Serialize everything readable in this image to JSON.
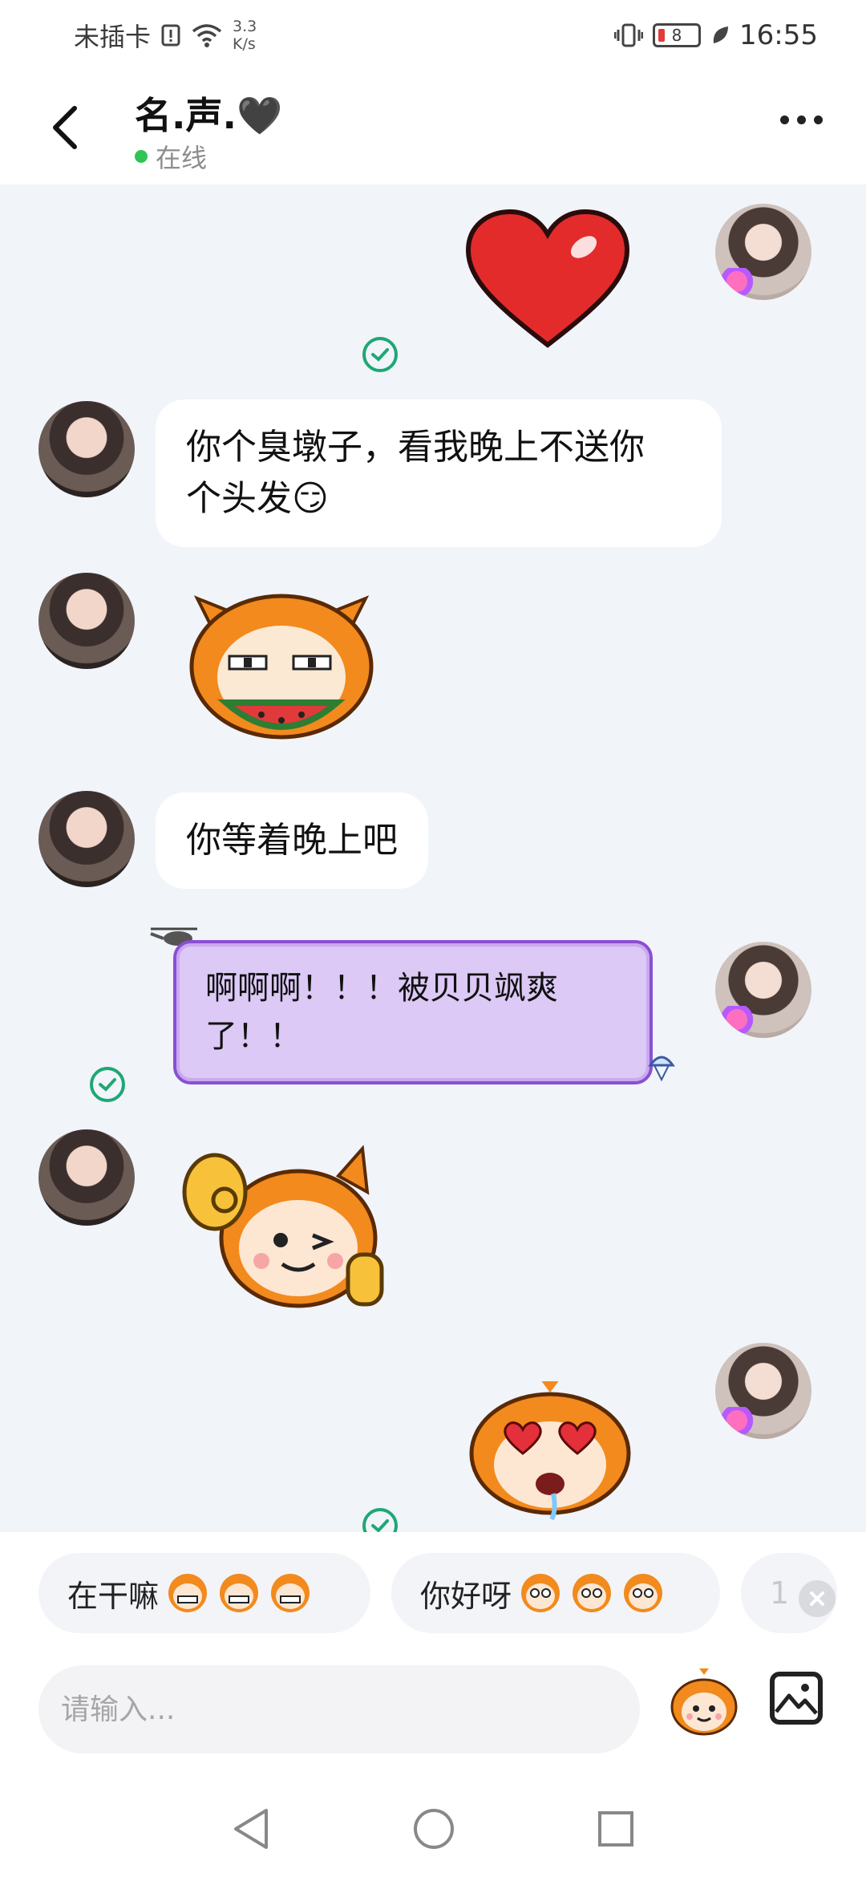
{
  "status_bar": {
    "carrier": "未插卡",
    "net_speed_value": "3.3",
    "net_speed_unit": "K/s",
    "battery": "8",
    "time": "16:55"
  },
  "header": {
    "contact_name": "名.声.🖤",
    "status": "在线"
  },
  "messages": [
    {
      "from": "me",
      "type": "sticker",
      "sticker": "red-heart",
      "read": true
    },
    {
      "from": "them",
      "type": "text",
      "text_line1": "你个臭墩子，看我晚上不送你",
      "text_line2": "个头发😏"
    },
    {
      "from": "them",
      "type": "sticker",
      "sticker": "monkey-eating-watermelon"
    },
    {
      "from": "them",
      "type": "text",
      "text": "你等着晚上吧"
    },
    {
      "from": "me",
      "type": "text",
      "style": "purple-bubble",
      "text_line1": "啊啊啊！！！被贝贝飒爽",
      "text_line2": "了！！",
      "read": true
    },
    {
      "from": "them",
      "type": "sticker",
      "sticker": "monkey-wink-thumbs-up"
    },
    {
      "from": "me",
      "type": "sticker",
      "sticker": "monkey-heart-eyes",
      "read": true
    }
  ],
  "quick_replies": [
    {
      "label": "在干嘛"
    },
    {
      "label": "你好呀"
    },
    {
      "label": "1"
    }
  ],
  "input": {
    "placeholder": "请输入..."
  },
  "colors": {
    "online": "#2fc556",
    "read_check": "#1ea774",
    "purple_bubble_bg": "#dcc9f6",
    "purple_bubble_border": "#8a4fd2",
    "chat_bg": "#f1f4f9"
  },
  "icons": {
    "back": "chevron-left-icon",
    "more": "more-dots-icon",
    "sticker_button": "monkey-sticker-icon",
    "image_button": "image-icon",
    "nav_back": "triangle-back-icon",
    "nav_home": "circle-home-icon",
    "nav_recents": "square-recents-icon"
  }
}
